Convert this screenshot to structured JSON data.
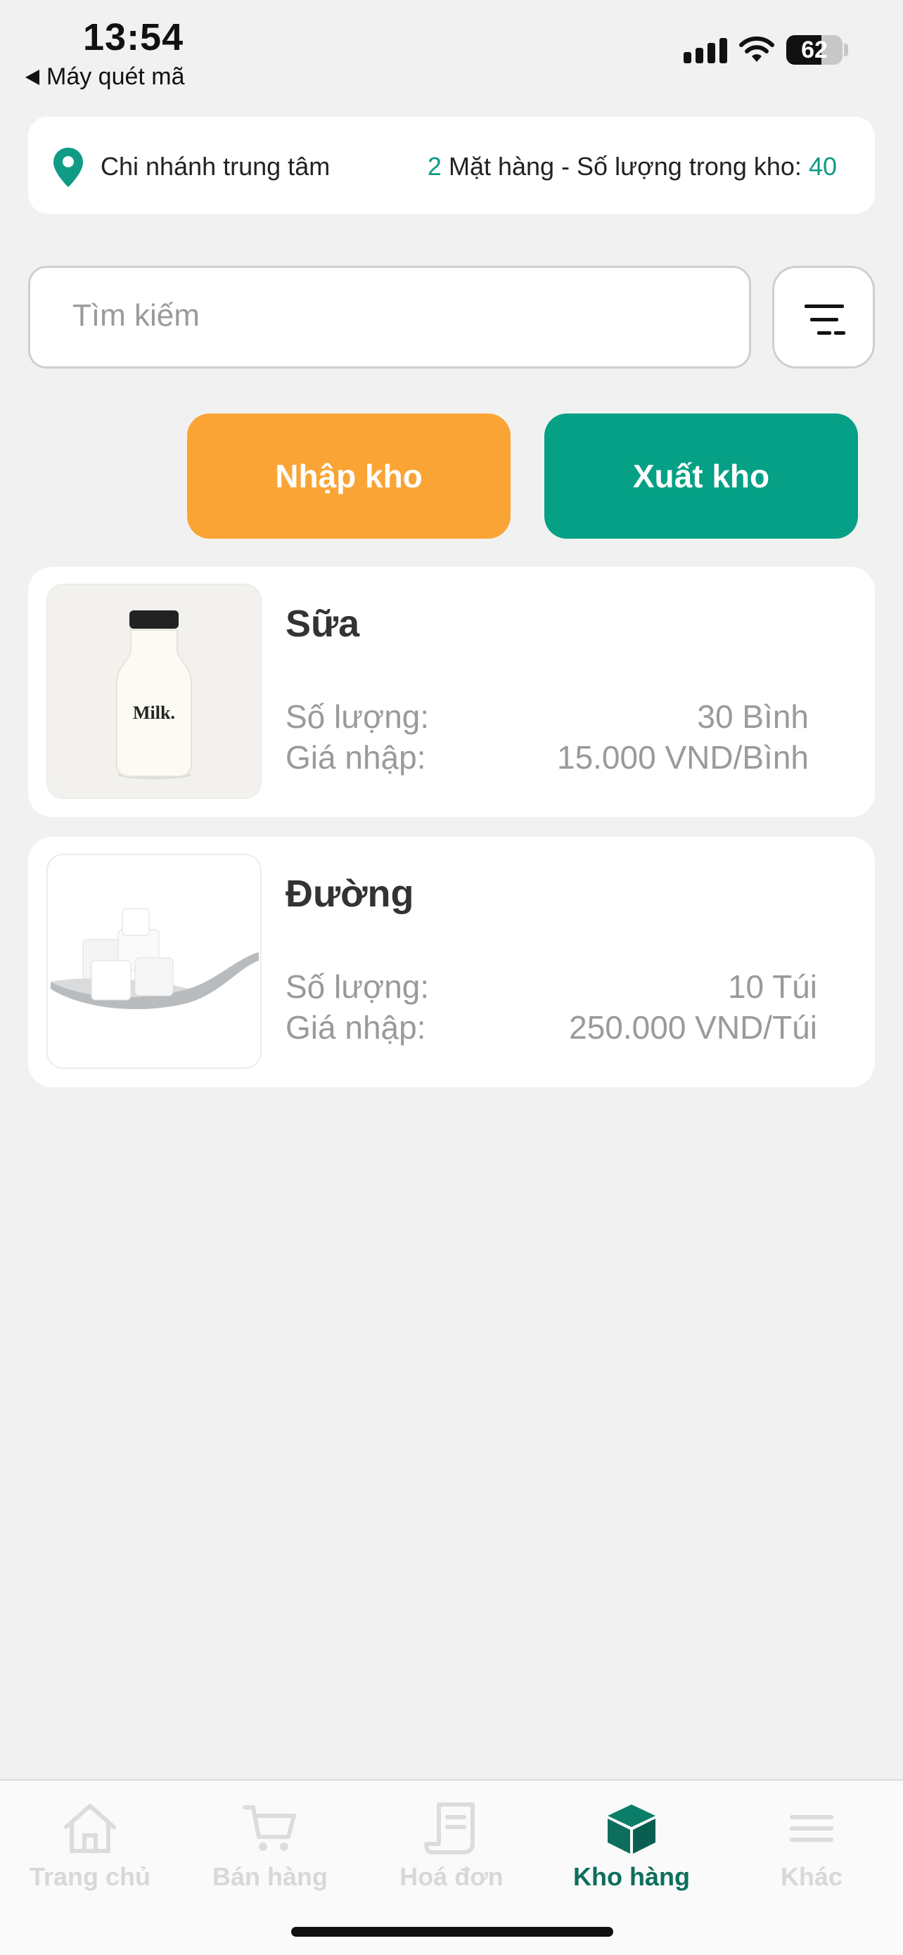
{
  "status_bar": {
    "time": "13:54",
    "back_app": "Máy quét mã",
    "battery": "62",
    "battery_level": 0.62
  },
  "branch": {
    "name": "Chi nhánh trung tâm",
    "item_count": "2",
    "stats_label": "Mặt hàng - Số lượng trong kho:",
    "stock_total": "40"
  },
  "search": {
    "placeholder": "Tìm kiếm",
    "value": ""
  },
  "actions": {
    "import_label": "Nhập kho",
    "export_label": "Xuất kho"
  },
  "products": [
    {
      "name": "Sữa",
      "qty_label": "Số lượng:",
      "qty_value": "30 Bình",
      "price_label": "Giá nhập:",
      "price_value": "15.000 VND/Bình",
      "image_text": "Milk."
    },
    {
      "name": "Đường",
      "qty_label": "Số lượng:",
      "qty_value": "10 Túi",
      "price_label": "Giá nhập:",
      "price_value": "250.000 VND/Túi"
    }
  ],
  "nav": [
    {
      "label": "Trang chủ",
      "icon": "home-icon",
      "active": false
    },
    {
      "label": "Bán hàng",
      "icon": "cart-icon",
      "active": false
    },
    {
      "label": "Hoá đơn",
      "icon": "receipt-icon",
      "active": false
    },
    {
      "label": "Kho hàng",
      "icon": "box-icon",
      "active": true
    },
    {
      "label": "Khác",
      "icon": "menu-icon",
      "active": false
    }
  ],
  "colors": {
    "accent_green": "#05a085",
    "import_orange": "#faa435",
    "nav_active": "#0e6e5e",
    "nav_inactive": "#d8d8d8"
  }
}
